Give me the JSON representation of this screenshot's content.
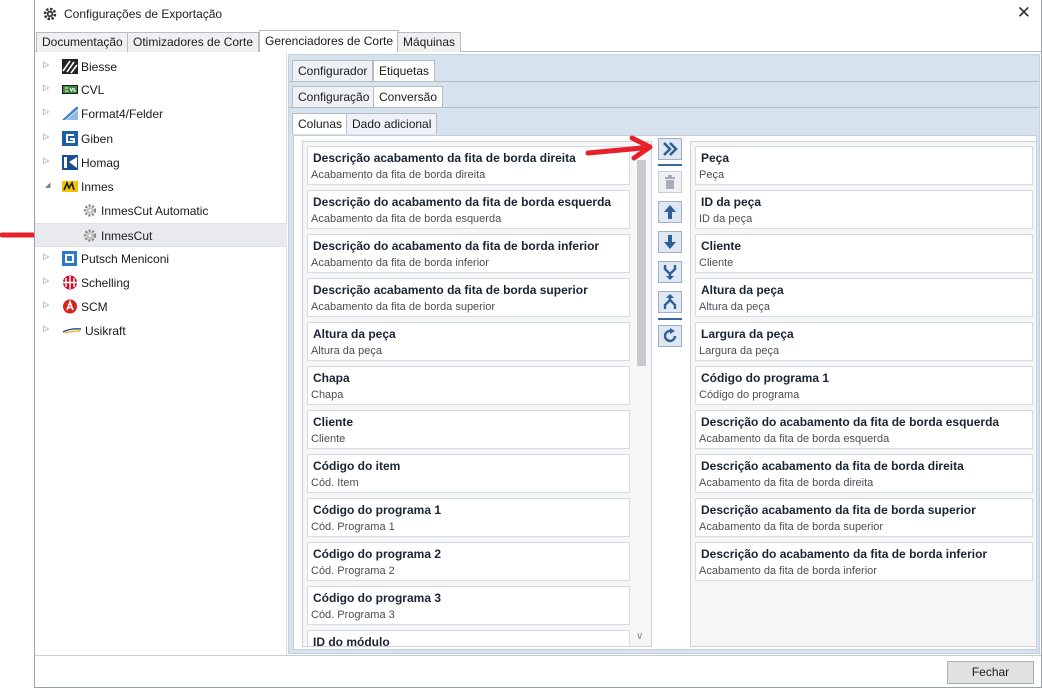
{
  "window": {
    "title": "Configurações de Exportação",
    "close_glyph": "✕"
  },
  "main_tabs": [
    "Documentação",
    "Otimizadores de Corte",
    "Gerenciadores de Corte",
    "Máquinas"
  ],
  "tree": [
    {
      "label": "Biesse",
      "icon": "biesse-logo-icon",
      "expander": "▷"
    },
    {
      "label": "CVL",
      "icon": "cvl-logo-icon",
      "expander": "▷"
    },
    {
      "label": "Format4/Felder",
      "icon": "format4-logo-icon",
      "expander": "▷"
    },
    {
      "label": "Giben",
      "icon": "giben-logo-icon",
      "expander": "▷"
    },
    {
      "label": "Homag",
      "icon": "homag-logo-icon",
      "expander": "▷"
    },
    {
      "label": "Inmes",
      "icon": "inmes-logo-icon",
      "expander": "◢"
    },
    {
      "label": "InmesCut Automatic",
      "icon": "gear-icon"
    },
    {
      "label": "InmesCut",
      "icon": "gear-icon"
    },
    {
      "label": "Putsch Meniconi",
      "icon": "putsch-logo-icon",
      "expander": "▷"
    },
    {
      "label": "Schelling",
      "icon": "schelling-logo-icon",
      "expander": "▷"
    },
    {
      "label": "SCM",
      "icon": "scm-logo-icon",
      "expander": "▷"
    },
    {
      "label": "Usikraft",
      "icon": "usikraft-logo-icon",
      "expander": "▷"
    }
  ],
  "sub_tabs_1": [
    "Configurador",
    "Etiquetas"
  ],
  "sub_tabs_2": [
    "Configuração",
    "Conversão"
  ],
  "sub_tabs_3": [
    "Colunas",
    "Dado adicional"
  ],
  "available_columns": [
    {
      "title": "Descrição acabamento da fita de borda direita",
      "sub": "Acabamento da fita de borda direita"
    },
    {
      "title": "Descrição do acabamento da fita de borda esquerda",
      "sub": "Acabamento da fita de borda esquerda"
    },
    {
      "title": "Descrição do acabamento da fita de borda inferior",
      "sub": "Acabamento da fita de borda inferior"
    },
    {
      "title": "Descrição acabamento da fita de borda superior",
      "sub": "Acabamento da fita de borda superior"
    },
    {
      "title": "Altura da peça",
      "sub": "Altura da peça"
    },
    {
      "title": "Chapa",
      "sub": "Chapa"
    },
    {
      "title": "Cliente",
      "sub": "Cliente"
    },
    {
      "title": "Código do item",
      "sub": "Cód. Item"
    },
    {
      "title": "Código do programa 1",
      "sub": "Cód. Programa 1"
    },
    {
      "title": "Código do programa 2",
      "sub": "Cód. Programa 2"
    },
    {
      "title": "Código do programa 3",
      "sub": "Cód. Programa 3"
    },
    {
      "title": "ID do módulo",
      "sub": ""
    }
  ],
  "selected_columns": [
    {
      "title": "Peça",
      "sub": "Peça"
    },
    {
      "title": "ID da peça",
      "sub": "ID da peça"
    },
    {
      "title": "Cliente",
      "sub": "Cliente"
    },
    {
      "title": "Altura da peça",
      "sub": "Altura da peça"
    },
    {
      "title": "Largura da peça",
      "sub": "Largura da peça"
    },
    {
      "title": "Código do programa 1",
      "sub": "Código do programa"
    },
    {
      "title": "Descrição do acabamento da fita de borda esquerda",
      "sub": "Acabamento da fita de borda esquerda"
    },
    {
      "title": "Descrição acabamento da fita de borda direita",
      "sub": "Acabamento da fita de borda direita"
    },
    {
      "title": "Descrição acabamento da fita de borda superior",
      "sub": "Acabamento da fita de borda superior"
    },
    {
      "title": "Descrição do acabamento da fita de borda inferior",
      "sub": "Acabamento da fita de borda inferior"
    }
  ],
  "toolbar_icons": [
    "add-all-icon",
    "delete-icon",
    "move-up-icon",
    "move-down-icon",
    "merge-icon",
    "split-icon",
    "refresh-icon"
  ],
  "scroll_down_glyph": "∨",
  "close_button": "Fechar",
  "colors": {
    "accent": "#3a68a3",
    "annotation": "#e8202a",
    "panel_blue": "#d6e2ee"
  }
}
